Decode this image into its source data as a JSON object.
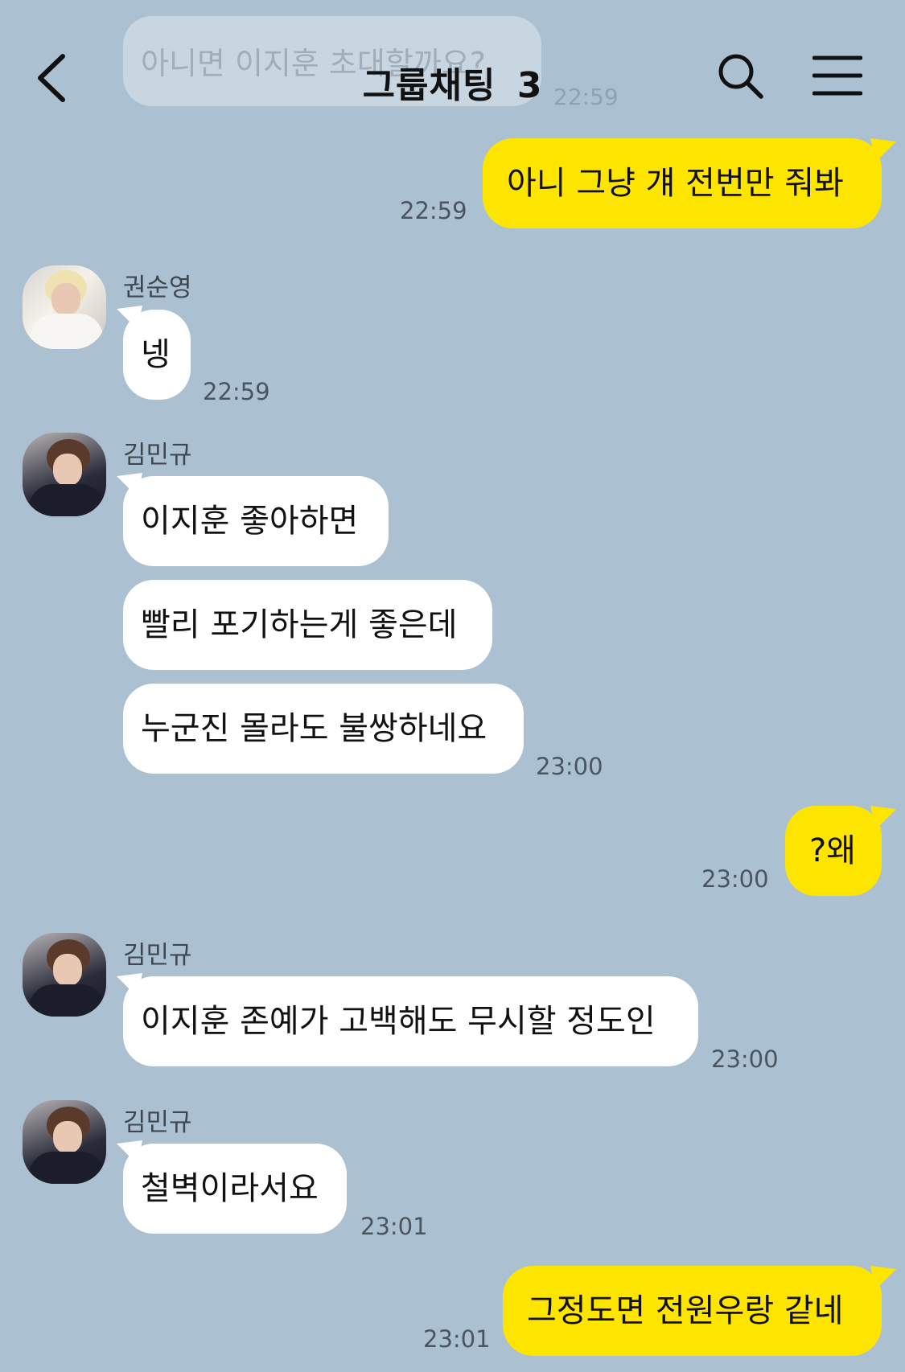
{
  "header": {
    "title": "그룹채팅",
    "member_count": "3",
    "behind_bubble_text": "아니면 이지훈 초대할까요?",
    "behind_bubble_time": "22:59",
    "back_icon": "chevron-left-icon",
    "search_icon": "search-icon",
    "menu_icon": "hamburger-menu-icon"
  },
  "colors": {
    "background": "#abc1d1",
    "my_bubble": "#fee500",
    "other_bubble": "#ffffff"
  },
  "messages": [
    {
      "side": "me",
      "text": "아니 그냥 걔 전번만 줘봐",
      "time": "22:59"
    },
    {
      "side": "other",
      "sender": "권순영",
      "text": "넹",
      "time": "22:59"
    },
    {
      "side": "other",
      "sender": "김민규",
      "text": "이지훈 좋아하면"
    },
    {
      "side": "other",
      "text": "빨리 포기하는게 좋은데"
    },
    {
      "side": "other",
      "text": "누군진 몰라도 불쌍하네요",
      "time": "23:00"
    },
    {
      "side": "me",
      "text": "?왜",
      "time": "23:00"
    },
    {
      "side": "other",
      "sender": "김민규",
      "text": "이지훈 존예가 고백해도 무시할 정도인",
      "time": "23:00"
    },
    {
      "side": "other",
      "sender": "김민규",
      "text": "철벽이라서요",
      "time": "23:01"
    },
    {
      "side": "me",
      "text": "그정도면 전원우랑 같네",
      "time": "23:01"
    }
  ]
}
